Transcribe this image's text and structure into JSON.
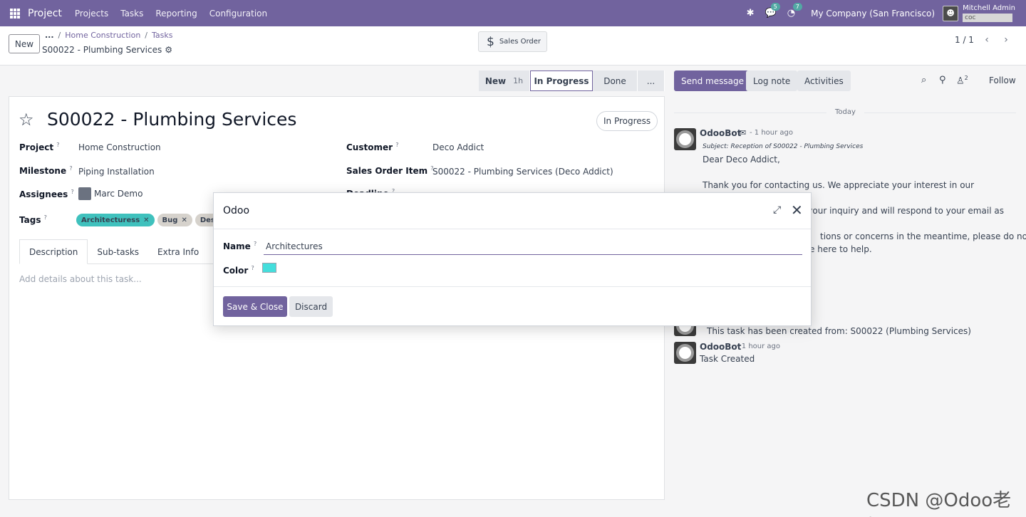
{
  "topbar": {
    "app_name": "Project",
    "menu": [
      "Projects",
      "Tasks",
      "Reporting",
      "Configuration"
    ],
    "messages_badge": "5",
    "activities_badge": "7",
    "company": "My Company (San Francisco)",
    "user_name": "Mitchell Admin",
    "user_db": "coc"
  },
  "control": {
    "new_label": "New",
    "breadcrumb_dots": "...",
    "breadcrumb": [
      "Home Construction",
      "Tasks"
    ],
    "current_record": "S00022 - Plumbing Services",
    "sales_order_label": "Sales Order",
    "pager": "1 / 1"
  },
  "statusbar": {
    "stages": [
      {
        "label": "New",
        "duration": "1h"
      },
      {
        "label": "In Progress"
      },
      {
        "label": "Done"
      },
      {
        "label": "..."
      }
    ]
  },
  "form": {
    "title": "S00022 - Plumbing Services",
    "state": "In Progress",
    "fields": {
      "project_label": "Project",
      "project_value": "Home Construction",
      "milestone_label": "Milestone",
      "milestone_value": "Piping Installation",
      "assignees_label": "Assignees",
      "assignees_value": "Marc Demo",
      "tags_label": "Tags",
      "customer_label": "Customer",
      "customer_value": "Deco Addict",
      "sales_order_item_label": "Sales Order Item",
      "sales_order_item_value": "S00022 - Plumbing Services (Deco Addict)",
      "deadline_label": "Deadline"
    },
    "tags": [
      {
        "label": "Architecturess",
        "color": "#3fc1bd"
      },
      {
        "label": "Bug",
        "color": "#d6d2cc"
      },
      {
        "label": "Desig",
        "color": "#d6d2cc"
      }
    ],
    "tabs": [
      "Description",
      "Sub-tasks",
      "Extra Info"
    ],
    "description_placeholder": "Add details about this task..."
  },
  "chatter": {
    "send_message": "Send message",
    "log_note": "Log note",
    "activities": "Activities",
    "followers_count": "2",
    "follow": "Follow",
    "date_separator": "Today",
    "messages": [
      {
        "author": "OdooBot",
        "time": "- 1 hour ago",
        "subject": "Subject: Reception of S00022 - Plumbing Services",
        "lines": [
          "Dear Deco Addict,",
          "Thank you for contacting us. We appreciate your interest in our",
          "ring your inquiry and will respond to your email as",
          "tions or concerns in the meantime, please do not",
          "are here to help."
        ]
      },
      {
        "author": "",
        "time": "",
        "lines": [
          "This task has been created from: S00022 (Plumbing Services)"
        ]
      },
      {
        "author": "OdooBot",
        "time": "- 1 hour ago",
        "lines": [
          "Task Created"
        ]
      }
    ]
  },
  "dialog": {
    "title": "Odoo",
    "name_label": "Name",
    "name_value": "Architectures",
    "color_label": "Color",
    "color_value": "#44dedc",
    "save_label": "Save & Close",
    "discard_label": "Discard"
  },
  "watermark": "CSDN @Odoo老杨",
  "colors": {
    "brand": "#71639e",
    "teal": "#52a9a4"
  }
}
